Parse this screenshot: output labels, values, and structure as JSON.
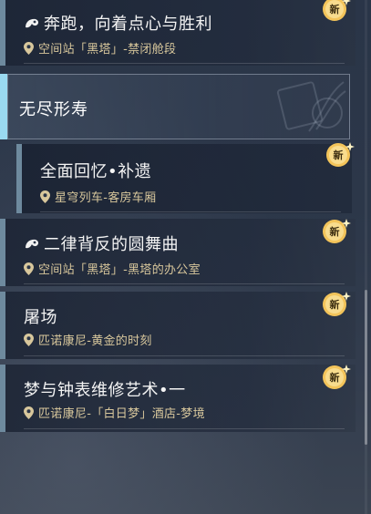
{
  "quests": [
    {
      "title": "奔跑，向着点心与胜利",
      "location": "空间站「黑塔」-禁闭舱段",
      "is_new": true,
      "has_tag_icon": true
    },
    {
      "title": "全面回忆•补遗",
      "location": "星穹列车-客房车厢",
      "is_new": true,
      "has_tag_icon": false
    },
    {
      "title": "二律背反的圆舞曲",
      "location": "空间站「黑塔」-黑塔的办公室",
      "is_new": true,
      "has_tag_icon": true
    },
    {
      "title": "屠场",
      "location": "匹诺康尼-黄金的时刻",
      "is_new": true,
      "has_tag_icon": false
    },
    {
      "title": "梦与钟表维修艺术•一",
      "location": "匹诺康尼-「白日梦」酒店-梦境",
      "is_new": true,
      "has_tag_icon": false
    }
  ],
  "chapter": {
    "title": "无尽形寿"
  },
  "new_badge_label": "新",
  "colors": {
    "accent_bar": "#6e8a9e",
    "chapter_bar": "#9ad9f0",
    "location_text": "#d8c79c",
    "badge_gold": "#f3c45a"
  },
  "icons": {
    "location": "map-pin-icon",
    "quest_tag": "companion-quest-icon",
    "new": "new-star-badge-icon"
  }
}
